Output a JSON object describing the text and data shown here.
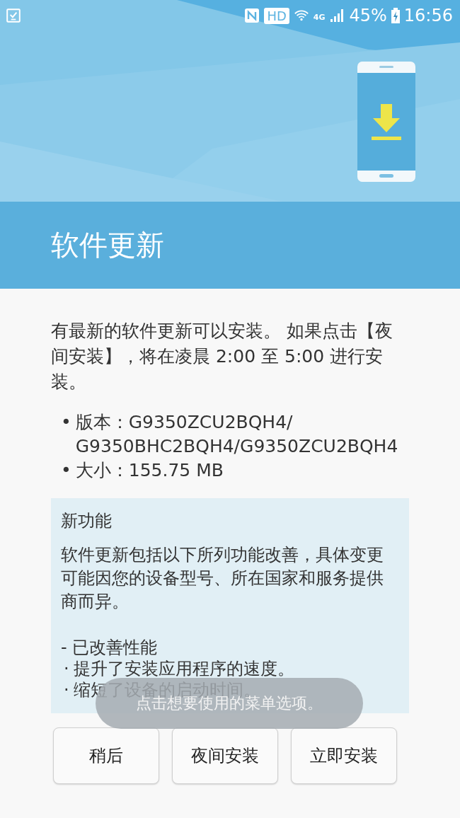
{
  "status_bar": {
    "hd_badge": "HD",
    "network": "4G",
    "battery": "45%",
    "time": "16:56"
  },
  "header": {
    "title": "软件更新"
  },
  "intro": "有最新的软件更新可以安装。 如果点击【夜间安装】，将在凌晨 2:00 至 5:00 进行安装。",
  "details": [
    {
      "bullet": "•",
      "text": "版本：G9350ZCU2BQH4/ G9350BHC2BQH4/G9350ZCU2BQH4"
    },
    {
      "bullet": "•",
      "text": "大小：155.75 MB"
    }
  ],
  "whats_new": {
    "heading": "新功能",
    "description": "软件更新包括以下所列功能改善，具体变更可能因您的设备型号、所在国家和服务提供商而异。",
    "section": "- 已改善性能",
    "items": [
      {
        "bullet": "·",
        "text": "提升了安装应用程序的速度。"
      },
      {
        "bullet": "·",
        "text": "缩短了设备的启动时间。"
      }
    ]
  },
  "toast": "点击想要使用的菜单选项。",
  "buttons": [
    "稍后",
    "夜间安装",
    "立即安装"
  ]
}
